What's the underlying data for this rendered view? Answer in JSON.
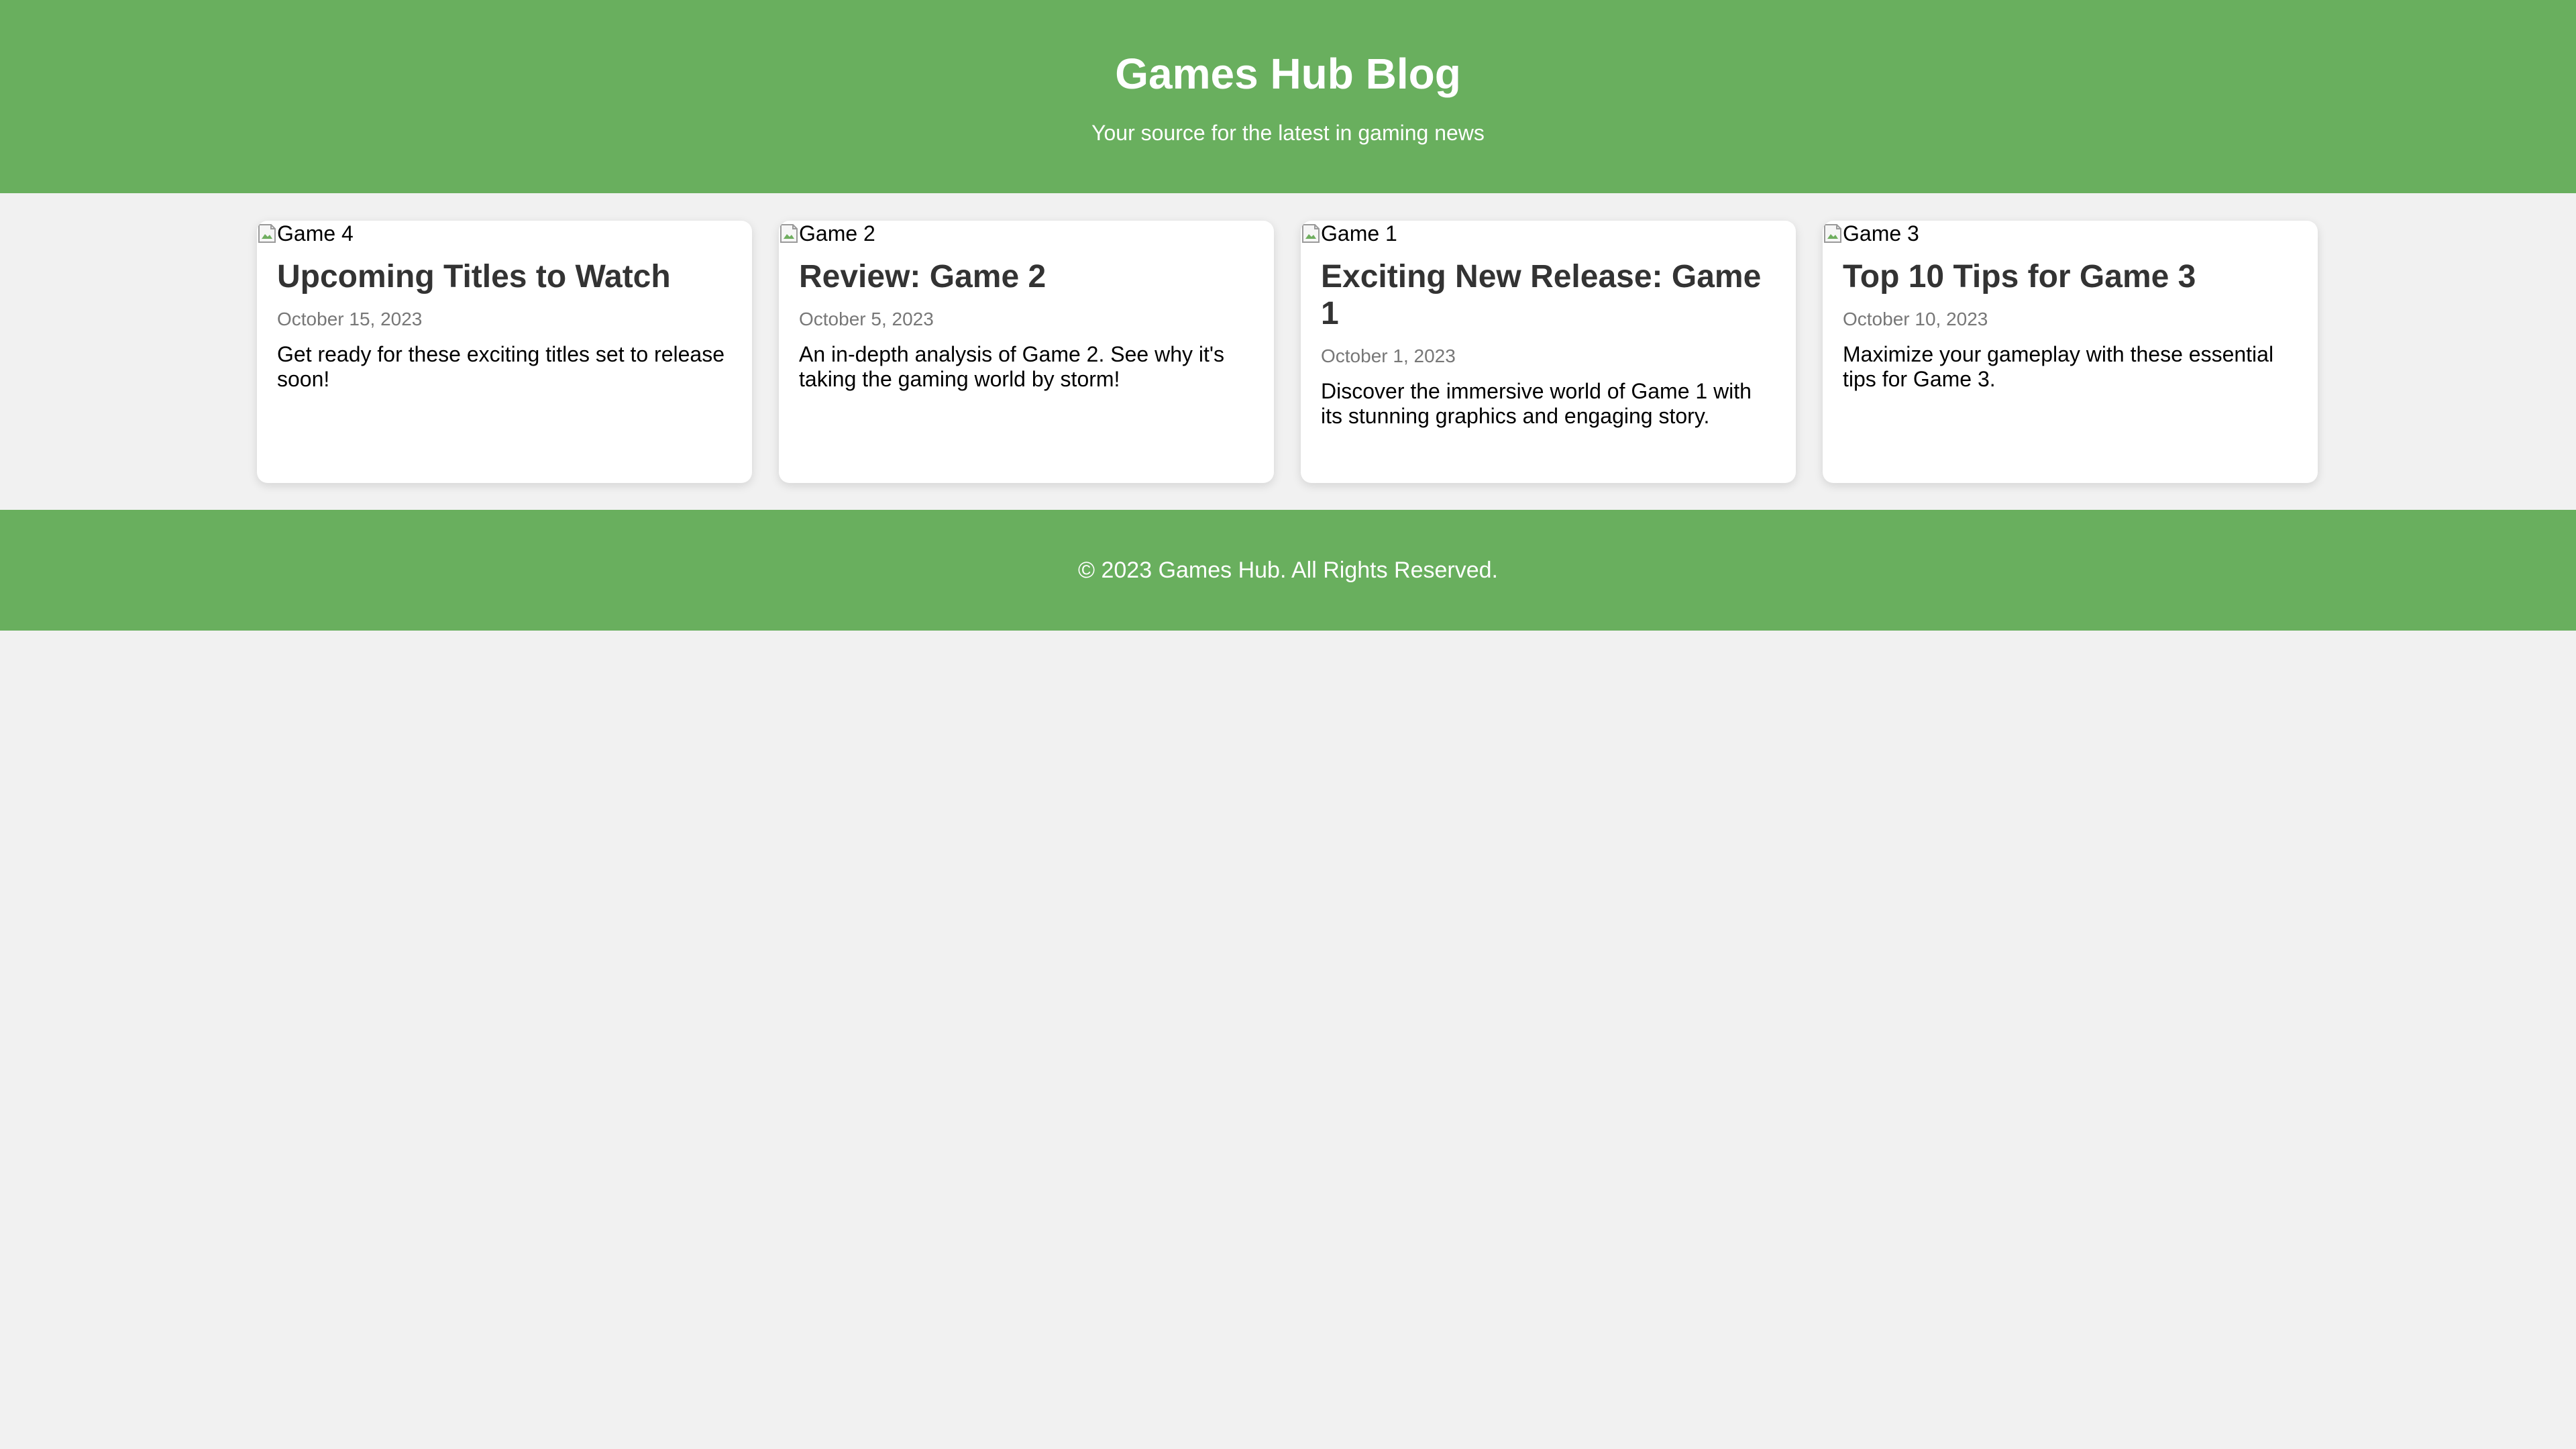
{
  "header": {
    "title": "Games Hub Blog",
    "tagline": "Your source for the latest in gaming news"
  },
  "posts": [
    {
      "image_alt": "Game 4",
      "title": "Upcoming Titles to Watch",
      "date": "October 15, 2023",
      "excerpt": "Get ready for these exciting titles set to release soon!"
    },
    {
      "image_alt": "Game 2",
      "title": "Review: Game 2",
      "date": "October 5, 2023",
      "excerpt": "An in-depth analysis of Game 2. See why it's taking the gaming world by storm!"
    },
    {
      "image_alt": "Game 1",
      "title": "Exciting New Release: Game 1",
      "date": "October 1, 2023",
      "excerpt": "Discover the immersive world of Game 1 with its stunning graphics and engaging story."
    },
    {
      "image_alt": "Game 3",
      "title": "Top 10 Tips for Game 3",
      "date": "October 10, 2023",
      "excerpt": "Maximize your gameplay with these essential tips for Game 3."
    }
  ],
  "footer": {
    "text": "© 2023 Games Hub. All Rights Reserved."
  },
  "colors": {
    "brand_green": "#69af5e",
    "page_background": "#f1f1f1",
    "card_background": "#ffffff",
    "title_text": "#333333",
    "date_text": "#777777"
  },
  "icons": {
    "broken_image": "broken-image-icon"
  }
}
